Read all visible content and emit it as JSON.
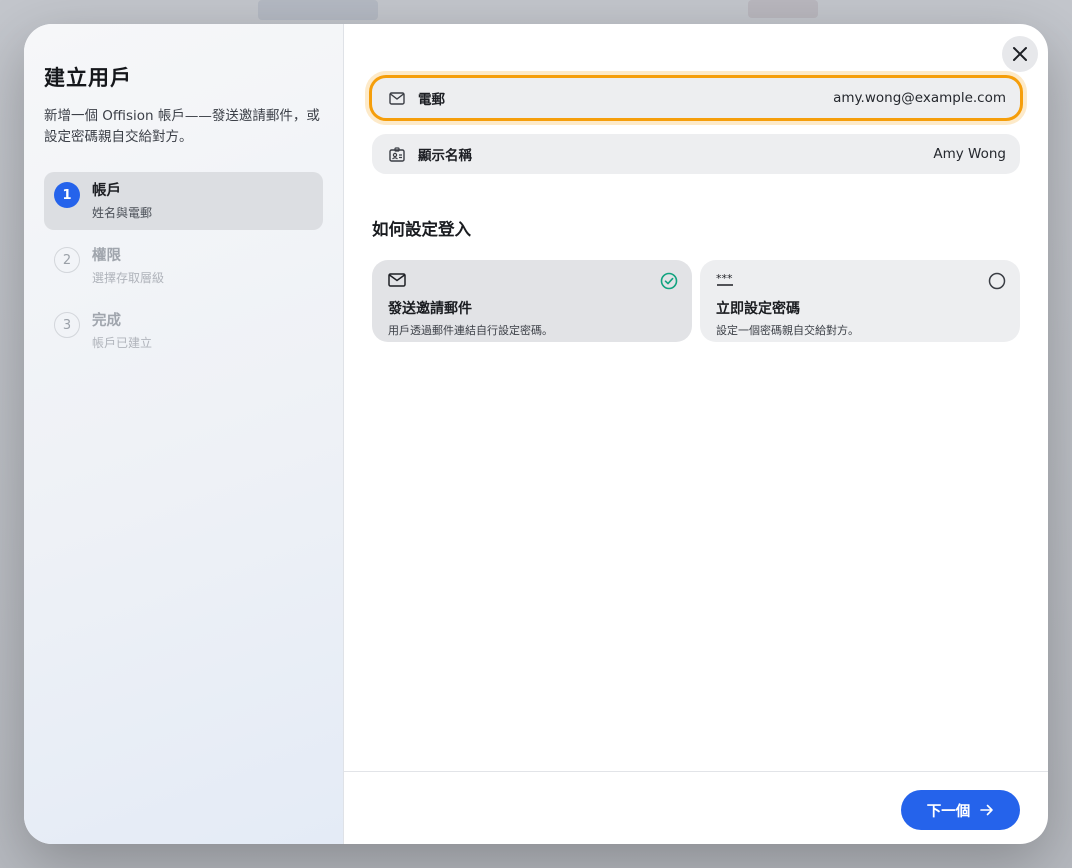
{
  "sidebar": {
    "title": "建立用戶",
    "description": "新增一個 Offision 帳戶——發送邀請郵件，或設定密碼親自交給對方。",
    "steps": [
      {
        "number": "1",
        "title": "帳戶",
        "subtitle": "姓名與電郵"
      },
      {
        "number": "2",
        "title": "權限",
        "subtitle": "選擇存取層級"
      },
      {
        "number": "3",
        "title": "完成",
        "subtitle": "帳戶已建立"
      }
    ]
  },
  "form": {
    "email_label": "電郵",
    "email_value": "amy.wong@example.com",
    "name_label": "顯示名稱",
    "name_value": "Amy Wong"
  },
  "signin": {
    "title": "如何設定登入",
    "options": [
      {
        "title": "發送邀請郵件",
        "subtitle": "用戶透過郵件連結自行設定密碼。",
        "selected": true
      },
      {
        "title": "立即設定密碼",
        "subtitle": "設定一個密碼親自交給對方。",
        "selected": false
      }
    ]
  },
  "footer": {
    "next_label": "下一個"
  },
  "colors": {
    "accent": "#2563eb",
    "focus_ring": "#f59e0b",
    "check": "#10a37f"
  }
}
